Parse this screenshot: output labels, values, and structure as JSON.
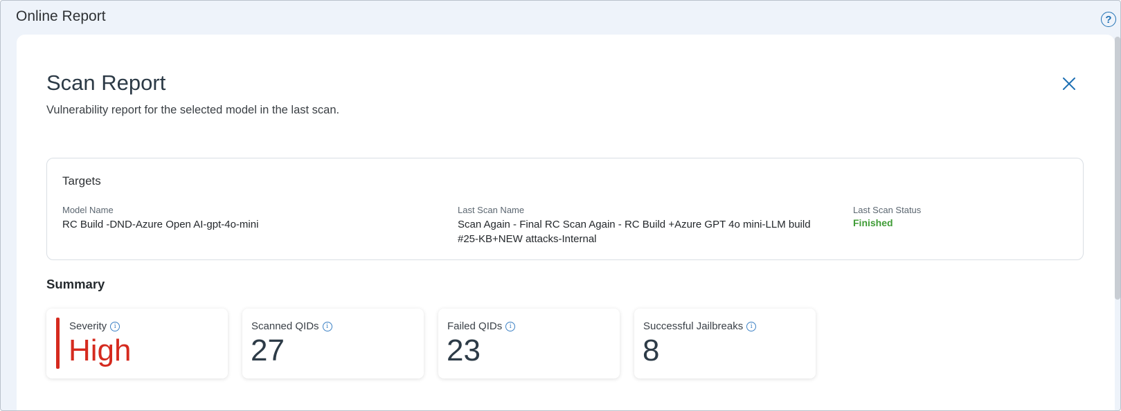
{
  "window": {
    "title": "Online Report",
    "help_icon": "question-circle-icon"
  },
  "report": {
    "title": "Scan Report",
    "subtitle": "Vulnerability report for the selected model in the last scan.",
    "close_icon": "close-x-icon"
  },
  "targets": {
    "heading": "Targets",
    "model_name_label": "Model Name",
    "model_name_value": "RC Build -DND-Azure Open AI-gpt-4o-mini",
    "last_scan_name_label": "Last Scan Name",
    "last_scan_name_value": "Scan Again - Final RC Scan Again - RC Build +Azure GPT 4o mini-LLM build #25-KB+NEW attacks-Internal",
    "last_scan_status_label": "Last Scan Status",
    "last_scan_status_value": "Finished"
  },
  "summary": {
    "heading": "Summary",
    "tiles": [
      {
        "label": "Severity",
        "value": "High",
        "icon": "info-icon"
      },
      {
        "label": "Scanned QIDs",
        "value": "27",
        "icon": "info-icon"
      },
      {
        "label": "Failed QIDs",
        "value": "23",
        "icon": "info-icon"
      },
      {
        "label": "Successful Jailbreaks",
        "value": "8",
        "icon": "info-icon"
      }
    ]
  },
  "colors": {
    "accent": "#1d6fb3",
    "severity_high": "#d52a1e",
    "status_finished": "#3f9c36",
    "window_bg": "#eef3fa"
  }
}
